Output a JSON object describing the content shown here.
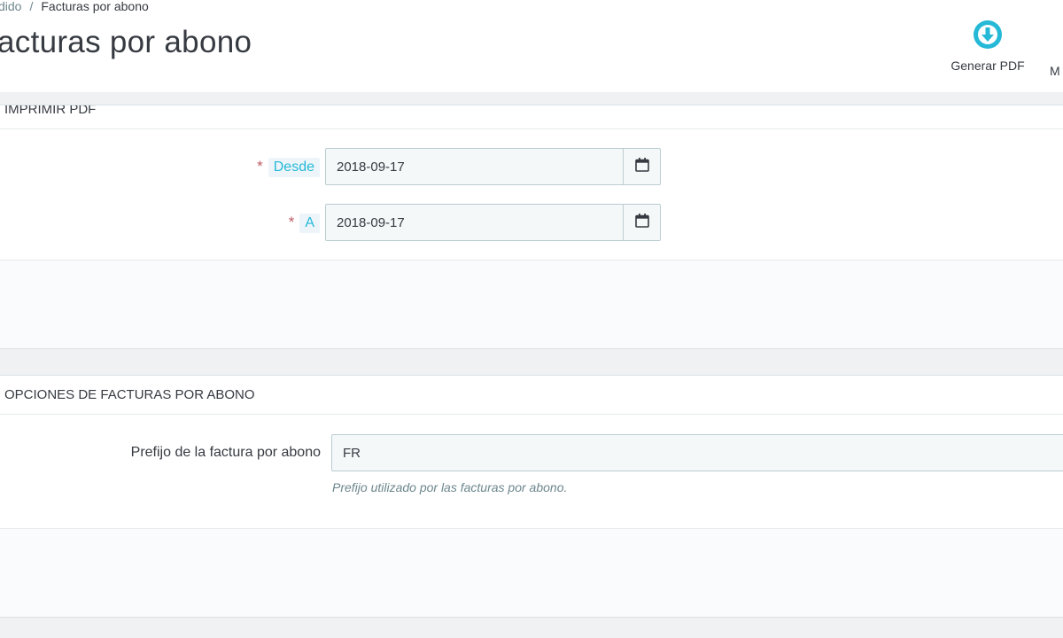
{
  "breadcrumb": {
    "parent": "dido",
    "current": "Facturas por abono",
    "separator": "/"
  },
  "header": {
    "title": "acturas por abono"
  },
  "toolbar": {
    "pdf_label": "Generar PDF",
    "more_label": "M"
  },
  "panel_print": {
    "heading": "IMPRIMIR PDF",
    "from": {
      "label": "Desde",
      "value": "2018-09-17",
      "required_mark": "*"
    },
    "to": {
      "label": "A",
      "value": "2018-09-17",
      "required_mark": "*"
    }
  },
  "panel_options": {
    "heading": "OPCIONES DE FACTURAS POR ABONO",
    "prefix": {
      "label": "Prefijo de la factura por abono",
      "value": "FR",
      "help": "Prefijo utilizado por las facturas por abono."
    }
  },
  "colors": {
    "accent": "#25b9d7",
    "required": "#c05c67",
    "text": "#363a41"
  },
  "icons": {
    "pdf": "download-circle-icon",
    "calendar": "calendar-icon"
  }
}
